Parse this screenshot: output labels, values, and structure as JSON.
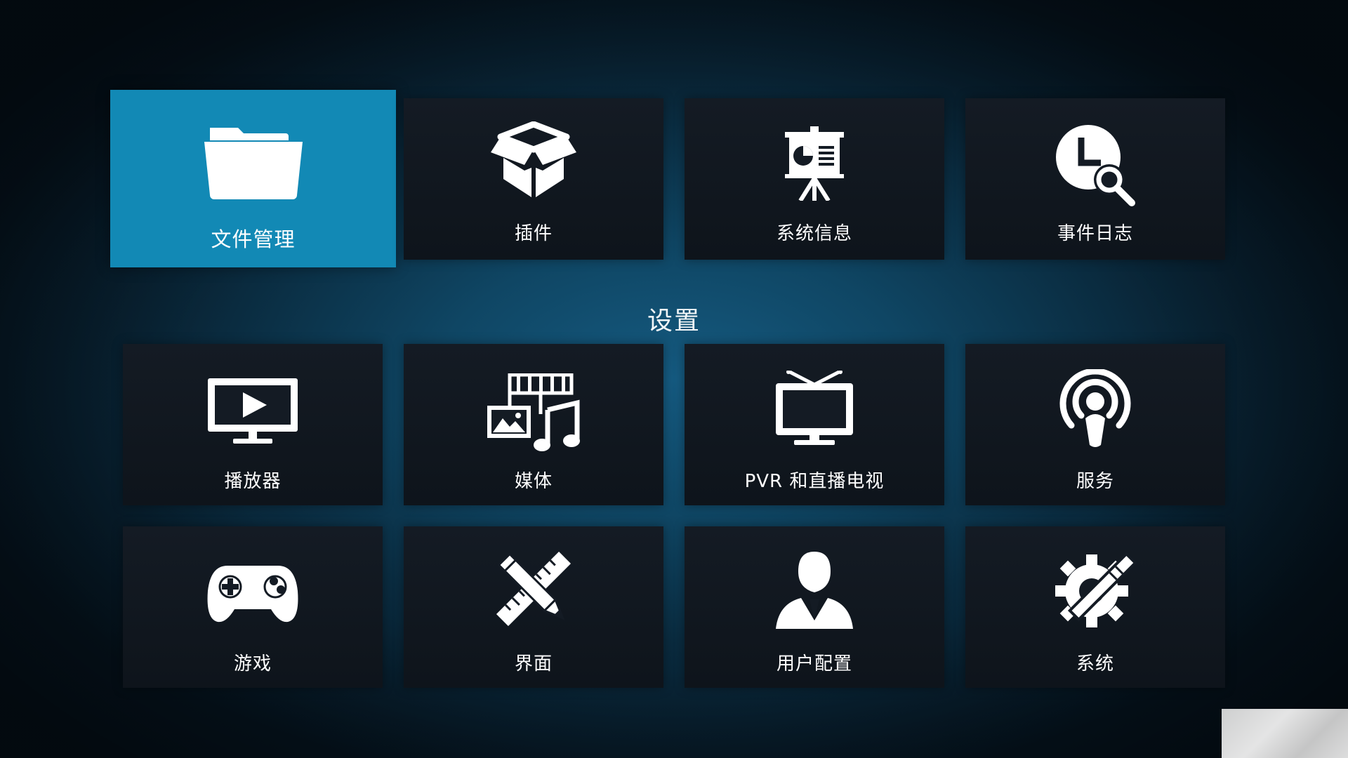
{
  "top_row": [
    {
      "label": "文件管理",
      "icon": "folder-icon",
      "focused": true
    },
    {
      "label": "插件",
      "icon": "addon-box-icon",
      "focused": false
    },
    {
      "label": "系统信息",
      "icon": "presentation-chart-icon",
      "focused": false
    },
    {
      "label": "事件日志",
      "icon": "clock-search-icon",
      "focused": false
    }
  ],
  "section": {
    "title": "设置"
  },
  "settings_row1": [
    {
      "label": "播放器",
      "icon": "tv-play-icon"
    },
    {
      "label": "媒体",
      "icon": "media-icon"
    },
    {
      "label": "PVR 和直播电视",
      "icon": "tv-antenna-icon"
    },
    {
      "label": "服务",
      "icon": "broadcast-icon"
    }
  ],
  "settings_row2": [
    {
      "label": "游戏",
      "icon": "gamepad-icon"
    },
    {
      "label": "界面",
      "icon": "pencil-ruler-icon"
    },
    {
      "label": "用户配置",
      "icon": "user-icon"
    },
    {
      "label": "系统",
      "icon": "gear-wrench-icon"
    }
  ],
  "colors": {
    "focus_tile": "#1289b5",
    "tile": "#121820",
    "background": "#0f4664"
  }
}
